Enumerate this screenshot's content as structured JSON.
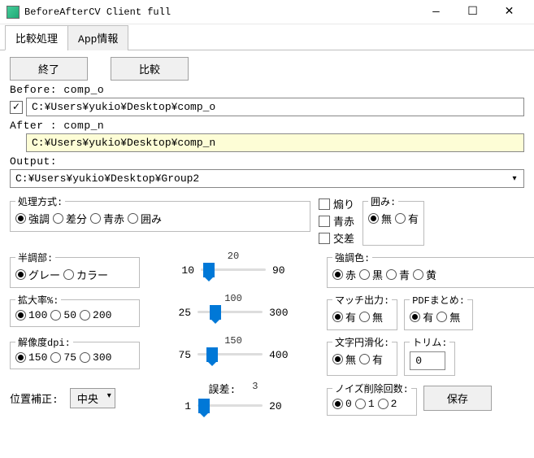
{
  "title": "BeforeAfterCV Client full",
  "tabs": {
    "compare": "比較処理",
    "appinfo": "App情報"
  },
  "buttons": {
    "quit": "終了",
    "compare": "比較",
    "save": "保存"
  },
  "before": {
    "label": "Before: comp_o",
    "path": "C:¥Users¥yukio¥Desktop¥comp_o",
    "checked": "✓"
  },
  "after": {
    "label": "After : comp_n",
    "path": "C:¥Users¥yukio¥Desktop¥comp_n"
  },
  "output": {
    "label": "Output:",
    "path": "C:¥Users¥yukio¥Desktop¥Group2"
  },
  "proc": {
    "legend": "処理方式:",
    "opts": [
      "強調",
      "差分",
      "青赤",
      "囲み"
    ],
    "selected": 0
  },
  "chk": {
    "items": [
      "煽り",
      "青赤",
      "交差"
    ]
  },
  "enclose": {
    "legend": "囲み:",
    "opts": [
      "無",
      "有"
    ],
    "selected": 0
  },
  "halftone": {
    "legend": "半調部:",
    "opts": [
      "グレー",
      "カラー"
    ],
    "selected": 0,
    "slider": {
      "min": "10",
      "max": "90",
      "val": "20",
      "pct": 13
    }
  },
  "accent": {
    "legend": "強調色:",
    "opts": [
      "赤",
      "黒",
      "青",
      "黄"
    ],
    "selected": 0
  },
  "zoom": {
    "legend": "拡大率%:",
    "opts": [
      "100",
      "50",
      "200"
    ],
    "selected": 0,
    "slider": {
      "min": "25",
      "max": "300",
      "val": "100",
      "pct": 27
    }
  },
  "match": {
    "legend": "マッチ出力:",
    "opts": [
      "有",
      "無"
    ],
    "selected": 0
  },
  "pdf": {
    "legend": "PDFまとめ:",
    "opts": [
      "有",
      "無"
    ],
    "selected": 0
  },
  "dpi": {
    "legend": "解像度dpi:",
    "opts": [
      "150",
      "75",
      "300"
    ],
    "selected": 0,
    "slider": {
      "min": "75",
      "max": "400",
      "val": "150",
      "pct": 23
    }
  },
  "smooth": {
    "legend": "文字円滑化:",
    "opts": [
      "無",
      "有"
    ],
    "selected": 0
  },
  "trim": {
    "legend": "トリム:",
    "value": "0"
  },
  "pos": {
    "label": "位置補正:",
    "select": "中央"
  },
  "err": {
    "label": "誤差:",
    "min": "1",
    "max": "20",
    "val": "3",
    "pct": 10
  },
  "noise": {
    "legend": "ノイズ削除回数:",
    "opts": [
      "0",
      "1",
      "2"
    ],
    "selected": 0
  }
}
